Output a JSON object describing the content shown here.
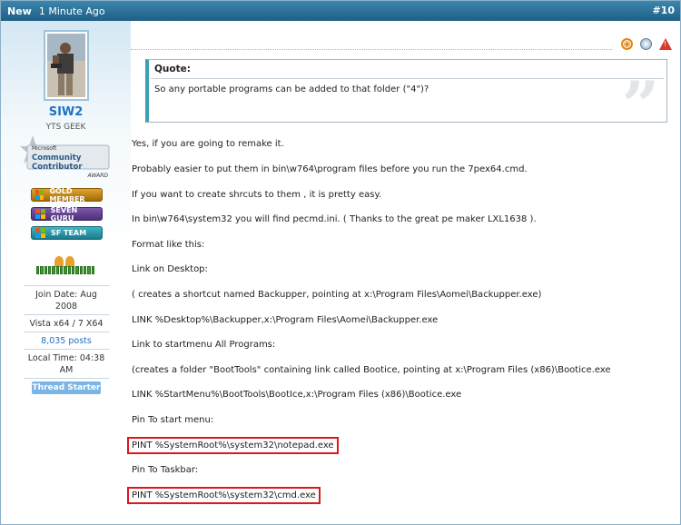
{
  "header": {
    "new_label": "New",
    "time_ago": "1 Minute Ago",
    "post_number": "#10",
    "bar_color": "#2a6e96"
  },
  "user": {
    "name": "SIW2",
    "title": "YTS GEEK",
    "award": {
      "line1": "Microsoft",
      "line2": "Community Contributor",
      "line3": "AWARD"
    },
    "ranks": [
      "GOLD MEMBER",
      "SEVEN GURU",
      "SF TEAM"
    ],
    "join_date": "Join Date: Aug 2008",
    "os": "Vista x64 / 7 X64",
    "posts": "8,035 posts",
    "local_time": "Local Time: 04:38 AM",
    "thread_starter": "Thread Starter",
    "name_color": "#1b73c2"
  },
  "post_icons": [
    "ip-icon",
    "reputation-icon",
    "report-icon"
  ],
  "quote": {
    "title": "Quote:",
    "text": "So any portable programs can be added to that folder (\"4\")?"
  },
  "lines": [
    "Yes, if you are going to remake it.",
    "Probably easier to put them in bin\\w764\\program files before you run the 7pex64.cmd.",
    "If you want to create shrcuts to them , it is pretty easy.",
    "In bin\\w764\\system32 you will find pecmd.ini. ( Thanks to the great pe maker LXL1638 ).",
    "Format like this:",
    "Link on Desktop:",
    "( creates a shortcut named Backupper, pointing at x:\\Program Files\\Aomei\\Backupper.exe)",
    "LINK %Desktop%\\Backupper,x:\\Program Files\\Aomei\\Backupper.exe",
    "Link to startmenu All Programs:",
    "(creates a folder \"BootTools\" containing link called Bootice, pointing at x:\\Program Files (x86)\\Bootice.exe",
    "LINK %StartMenu%\\BootTools\\BootIce,x:\\Program Files (x86)\\Bootice.exe",
    "Pin To start menu:"
  ],
  "highlight1": "PINT %SystemRoot%\\system32\\notepad.exe",
  "pin_taskbar": "Pin To Taskbar:",
  "highlight2": "PINT %SystemRoot%\\system32\\cmd.exe",
  "highlight_color": "#e0161b"
}
